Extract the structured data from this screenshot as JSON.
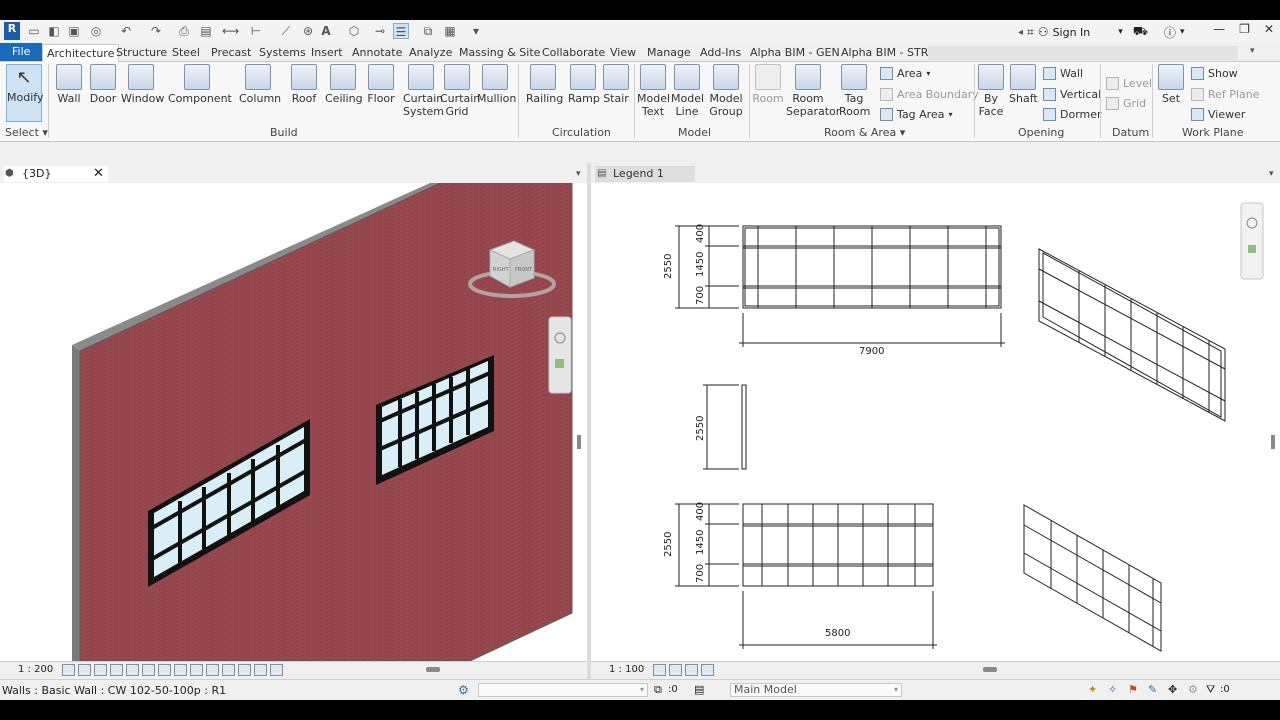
{
  "app": {
    "logo": "R",
    "sign_in": "Sign In"
  },
  "tabs": [
    "File",
    "Architecture",
    "Structure",
    "Steel",
    "Precast",
    "Systems",
    "Insert",
    "Annotate",
    "Analyze",
    "Massing & Site",
    "Collaborate",
    "View",
    "Manage",
    "Add-Ins",
    "Alpha BIM - GEN",
    "Alpha BIM - STR"
  ],
  "active_tab": "Architecture",
  "ribbon": {
    "select": {
      "modify": "Modify",
      "panel": "Select"
    },
    "build": {
      "wall": "Wall",
      "door": "Door",
      "window": "Window",
      "component": "Component",
      "column": "Column",
      "roof": "Roof",
      "ceiling": "Ceiling",
      "floor": "Floor",
      "curtain_system": "Curtain System",
      "curtain_grid": "Curtain Grid",
      "mullion": "Mullion",
      "panel": "Build"
    },
    "circulation": {
      "railing": "Railing",
      "ramp": "Ramp",
      "stair": "Stair",
      "panel": "Circulation"
    },
    "model": {
      "model_text": "Model Text",
      "model_line": "Model Line",
      "model_group": "Model Group",
      "panel": "Model"
    },
    "room_area": {
      "room": "Room",
      "room_separator": "Room Separator",
      "tag_room": "Tag Room",
      "area": "Area",
      "area_boundary": "Area  Boundary",
      "tag_area": "Tag  Area",
      "panel": "Room & Area"
    },
    "opening": {
      "by_face": "By Face",
      "shaft": "Shaft",
      "wall": "Wall",
      "vertical": "Vertical",
      "dormer": "Dormer",
      "panel": "Opening"
    },
    "datum": {
      "level": "Level",
      "grid": "Grid",
      "panel": "Datum"
    },
    "work_plane": {
      "set": "Set",
      "show": "Show",
      "ref_plane": "Ref  Plane",
      "viewer": "Viewer",
      "panel": "Work Plane"
    }
  },
  "views": {
    "left": {
      "title": "{3D}",
      "scale": "1 : 200",
      "viewcube_front": "FRONT",
      "viewcube_right": "RIGHT"
    },
    "right": {
      "title": "Legend 1",
      "scale": "1 : 100"
    }
  },
  "legend": {
    "dims_top": {
      "total": "2550",
      "top": "400",
      "mid": "1450",
      "bottom": "700",
      "width": "7900"
    },
    "dims_side": {
      "height": "2550"
    },
    "dims_bottom": {
      "total": "2550",
      "top": "400",
      "mid": "1450",
      "bottom": "700",
      "width": "5800"
    }
  },
  "status": {
    "text": "Walls : Basic Wall : CW 102-50-100p : R1",
    "worksets_count": ":0",
    "model": "Main Model",
    "filter_count": ":0"
  },
  "colors": {
    "brick": "#9b4a50",
    "accent": "#1c6bb8"
  }
}
